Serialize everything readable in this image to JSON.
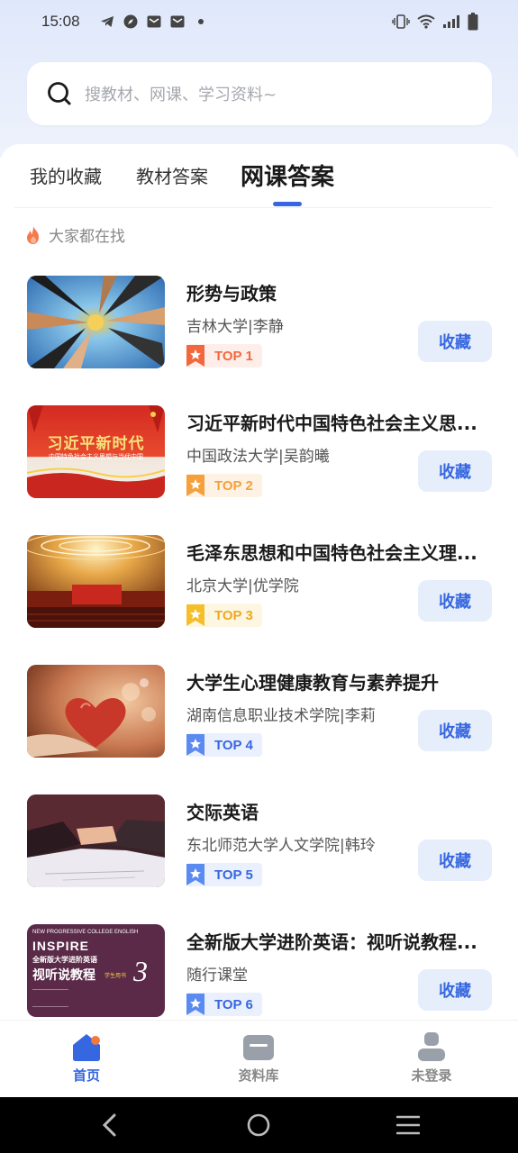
{
  "status_bar": {
    "time": "15:08"
  },
  "search": {
    "placeholder": "搜教材、网课、学习资料~"
  },
  "tabs": [
    {
      "label": "我的收藏",
      "active": false
    },
    {
      "label": "教材答案",
      "active": false
    },
    {
      "label": "网课答案",
      "active": true
    }
  ],
  "section": {
    "title": "大家都在找"
  },
  "courses": [
    {
      "title": "形势与政策",
      "subtitle": "吉林大学|李静",
      "rank": "TOP 1",
      "fav_label": "收藏",
      "badge_color": "#f2683e"
    },
    {
      "title": "习近平新时代中国特色社会主义思...",
      "subtitle": "中国政法大学|吴韵曦",
      "rank": "TOP 2",
      "fav_label": "收藏",
      "badge_color": "#f5a03a",
      "thumb_text_main": "习近平新时代",
      "thumb_text_sub": "中国特色社会主义思想与当代中国"
    },
    {
      "title": "毛泽东思想和中国特色社会主义理...",
      "subtitle": "北京大学|优学院",
      "rank": "TOP 3",
      "fav_label": "收藏",
      "badge_color": "#f5bf2a"
    },
    {
      "title": "大学生心理健康教育与素养提升",
      "subtitle": "湖南信息职业技术学院|李莉",
      "rank": "TOP 4",
      "fav_label": "收藏",
      "badge_color": "#5b8af0"
    },
    {
      "title": "交际英语",
      "subtitle": "东北师范大学人文学院|韩玲",
      "rank": "TOP 5",
      "fav_label": "收藏",
      "badge_color": "#5b8af0"
    },
    {
      "title": "全新版大学进阶英语：视听说教程...",
      "subtitle": "随行课堂",
      "rank": "TOP 6",
      "fav_label": "收藏",
      "badge_color": "#5b8af0",
      "thumb_text_top": "NEW PROGRESSIVE COLLEGE ENGLISH",
      "thumb_text_brand": "INSPIRE",
      "thumb_text_cn1": "全新版大学进阶英语",
      "thumb_text_cn2": "视听说教程",
      "thumb_text_num": "3",
      "thumb_text_tag": "学生用书"
    }
  ],
  "bottom_nav": [
    {
      "label": "首页",
      "icon": "home-icon",
      "active": true
    },
    {
      "label": "资料库",
      "icon": "folder-icon",
      "active": false
    },
    {
      "label": "未登录",
      "icon": "user-icon",
      "active": false
    }
  ],
  "colors": {
    "accent": "#3667e0",
    "fav_bg": "#e6edfb"
  }
}
